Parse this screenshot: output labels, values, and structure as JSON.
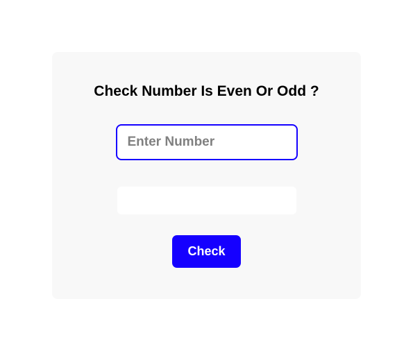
{
  "card": {
    "title": "Check Number Is Even Or Odd ?",
    "input": {
      "placeholder": "Enter Number",
      "value": ""
    },
    "result": "",
    "button_label": "Check"
  }
}
